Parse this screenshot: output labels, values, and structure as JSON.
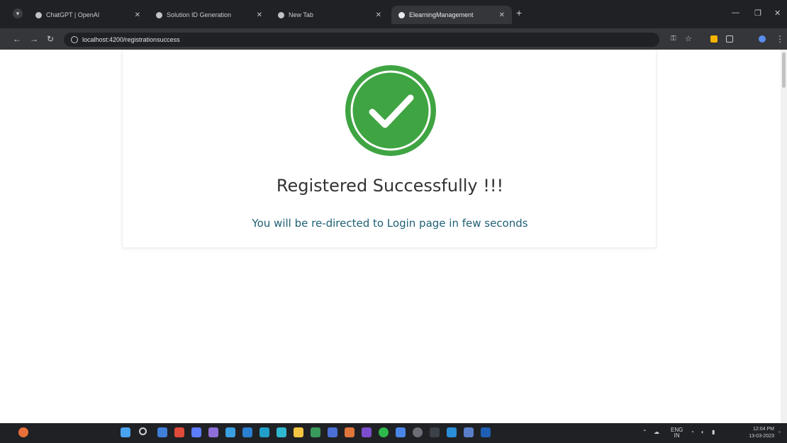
{
  "browser": {
    "tabs": [
      {
        "title": "ChatGPT | OpenAI"
      },
      {
        "title": "Solution ID Generation"
      },
      {
        "title": "New Tab"
      },
      {
        "title": "ElearningManagement"
      }
    ],
    "url": "localhost:4200/registrationsuccess"
  },
  "page": {
    "title": "Registered Successfully !!!",
    "subtitle": "You will be re-directed to Login page in few seconds",
    "success_color": "#3fa442"
  },
  "taskbar": {
    "language": "ENG",
    "region": "IN",
    "time": "12:04 PM",
    "date": "13-03-2023"
  }
}
